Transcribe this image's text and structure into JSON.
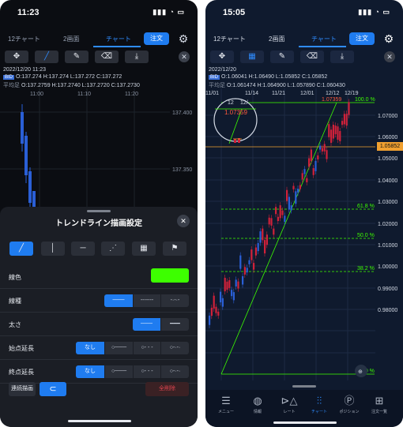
{
  "left": {
    "status_time": "11:23",
    "status_icons": "▮▮▮ ◔ ▭",
    "tabs": {
      "t1": "12チャート",
      "t2": "2画面",
      "t3": "チャート",
      "order": "注文"
    },
    "toolbar": {
      "move": "✥",
      "line": "╱",
      "draw": "✎",
      "eraser": "⌫",
      "tool5": "⤓",
      "close": "✕"
    },
    "date": "2022/12/20 11:23",
    "bid_tag": "BID",
    "ohlc_bid": "O:137.274  H:137.274  L:137.272  C:137.272",
    "avg_tag": "平均足",
    "ohlc_avg": "O:137.2759  H:137.2740  L:137.2720  C:137.2730",
    "time_labels": [
      "11:00",
      "11:10",
      "11:20"
    ],
    "price_labels": [
      "137.400",
      "137.350"
    ],
    "sheet": {
      "title": "トレンドライン描画設定",
      "close": "✕",
      "types": [
        "╱",
        "│",
        "─",
        "⋰",
        "▦",
        "⚑"
      ],
      "color_label": "線色",
      "color_value": "#3dff00",
      "style_label": "線種",
      "style_opts": [
        "───",
        "-------",
        "-·-·-"
      ],
      "width_label": "太さ",
      "width_opts": [
        "───",
        "━━━"
      ],
      "start_label": "始点延長",
      "end_label": "終点延長",
      "ext_opts": [
        "なし",
        "○───",
        "○- - -",
        "○-·-·"
      ],
      "continuous_label": "連続描画",
      "magnet": "⊂",
      "delete_all": "全削除"
    }
  },
  "right": {
    "status_time": "15:05",
    "status_icons": "▮▮▮ ◔ ▭",
    "tabs": {
      "t1": "12チャート",
      "t2": "2画面",
      "t3": "チャート",
      "order": "注文"
    },
    "toolbar": {
      "move": "✥",
      "table": "▦",
      "draw": "✎",
      "eraser": "⌫",
      "tool5": "⤓",
      "close": "✕"
    },
    "date": "2022/12/20",
    "bid_tag": "BID",
    "ohlc_bid": "O:1.06041  H:1.06490  L:1.05852  C:1.05852",
    "avg_tag": "平均足",
    "ohlc_avg": "O:1.061474  H:1.064900  L:1.057890  C:1.060430",
    "date_labels": [
      "11/01",
      "11/14",
      "11/21",
      "12/01",
      "12/12",
      "12/19"
    ],
    "magnifier_labels": [
      "12",
      "12/",
      "1.07359"
    ],
    "top_price_label": "1.07359",
    "fib_labels": [
      "100.0 %",
      "61.8 %",
      "50.0 %",
      "38.2 %",
      "0.0 %"
    ],
    "price_labels": [
      "1.07000",
      "1.06000",
      "1.05000",
      "1.04000",
      "1.03000",
      "1.02000",
      "1.01000",
      "1.00000",
      "0.99000",
      "0.98000"
    ],
    "current_price": "1.05852",
    "nav": [
      {
        "icon": "☰",
        "label": "メニュー"
      },
      {
        "icon": "◍",
        "label": "情報"
      },
      {
        "icon": "⊳△",
        "label": "レート"
      },
      {
        "icon": "⫶⫶",
        "label": "チャート"
      },
      {
        "icon": "Ⓟ",
        "label": "ポジション"
      },
      {
        "icon": "⊞",
        "label": "注文一覧"
      }
    ]
  },
  "colors": {
    "accent": "#1f7cf0",
    "bull": "#d0213a",
    "bear": "#2a5fd6",
    "trend": "#3dff00",
    "current": "#f0a030"
  }
}
